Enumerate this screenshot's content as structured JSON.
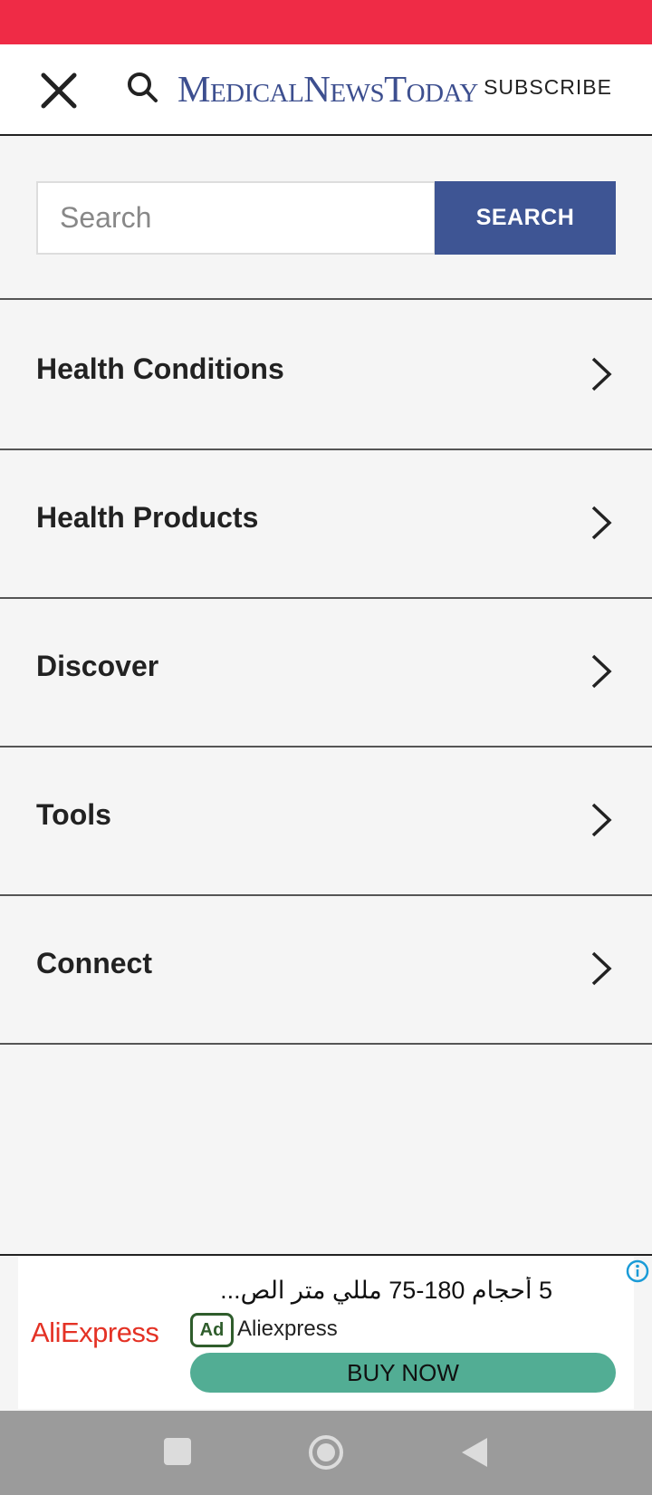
{
  "header": {
    "logo_parts": [
      "M",
      "EDICAL",
      "N",
      "EWS",
      "T",
      "ODAY"
    ],
    "subscribe_label": "SUBSCRIBE"
  },
  "search": {
    "placeholder": "Search",
    "button_label": "SEARCH"
  },
  "menu": {
    "items": [
      {
        "label": "Health Conditions"
      },
      {
        "label": "Health Products"
      },
      {
        "label": "Discover"
      },
      {
        "label": "Tools"
      },
      {
        "label": "Connect"
      }
    ]
  },
  "ad": {
    "brand_logo": "AliExpress",
    "title": "5 أحجام 180-75 مللي متر الص...",
    "badge": "Ad",
    "advertiser": "Aliexpress",
    "cta_label": "BUY NOW"
  },
  "colors": {
    "status_bar": "#ef2b46",
    "brand_blue": "#3e5594",
    "ad_cta": "#52ad94",
    "ad_logo": "#e43225"
  },
  "icons": {
    "close": "close-icon",
    "search": "search-icon",
    "chevron": "chevron-right-icon",
    "info": "info-icon"
  }
}
